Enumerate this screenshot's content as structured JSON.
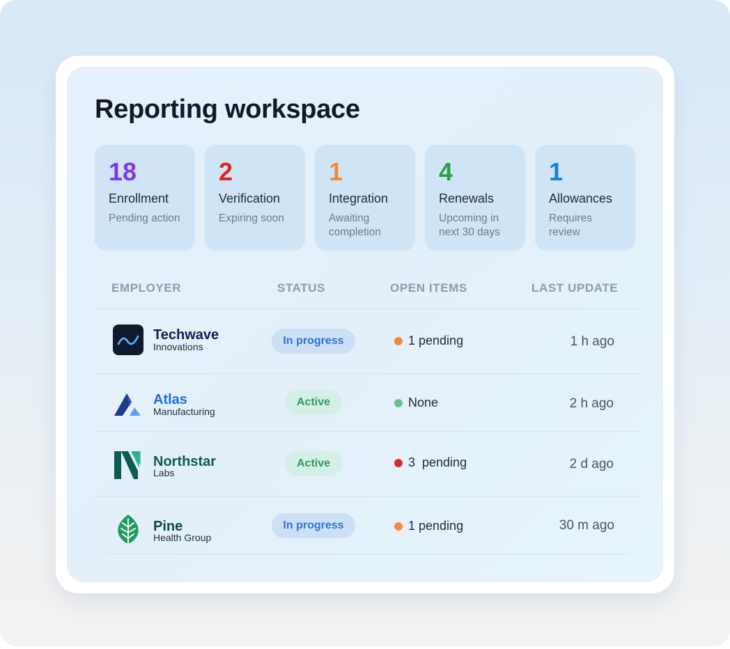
{
  "title": "Reporting workspace",
  "stats": [
    {
      "value": "18",
      "label": "Enrollment",
      "sub": "Pending action",
      "color": "#7c3aed"
    },
    {
      "value": "2",
      "label": "Verification",
      "sub": "Expiring soon",
      "color": "#dc2626"
    },
    {
      "value": "1",
      "label": "Integration",
      "sub": "Awaiting completion",
      "color": "#f2893a"
    },
    {
      "value": "4",
      "label": "Renewals",
      "sub": "Upcoming in next 30 days",
      "color": "#2f9e44"
    },
    {
      "value": "1",
      "label": "Allowances",
      "sub": "Requires review",
      "color": "#1b7fe0"
    }
  ],
  "table": {
    "headers": {
      "employer": "EMPLOYER",
      "status": "STATUS",
      "open_items": "OPEN ITEMS",
      "last_update": "LAST UPDATE"
    },
    "rows": [
      {
        "name": "Techwave",
        "subname": "Innovations",
        "name_color": "#0f1f4b",
        "logo": "techwave-logo-icon",
        "status": "In progress",
        "status_type": "progress",
        "open": "1 pending",
        "dot_color": "#f2893a",
        "updated": "1 h ago"
      },
      {
        "name": "Atlas",
        "subname": "Manufacturing",
        "name_color": "#1d6fd8",
        "logo": "atlas-logo-icon",
        "status": "Active",
        "status_type": "active",
        "open": "None",
        "dot_color": "#6bc08a",
        "updated": "2 h ago"
      },
      {
        "name": "Northstar",
        "subname": "Labs",
        "name_color": "#0c5b55",
        "logo": "northstar-logo-icon",
        "status": "Active",
        "status_type": "active",
        "open": "3  pending",
        "dot_color": "#d62d2d",
        "updated": "2 d ago"
      },
      {
        "name": "Pine",
        "subname": "Health Group",
        "name_color": "#0c4b3f",
        "logo": "pine-logo-icon",
        "status": "In progress",
        "status_type": "progress",
        "open": "1 pending",
        "dot_color": "#f2893a",
        "updated": "30 m ago"
      }
    ]
  }
}
